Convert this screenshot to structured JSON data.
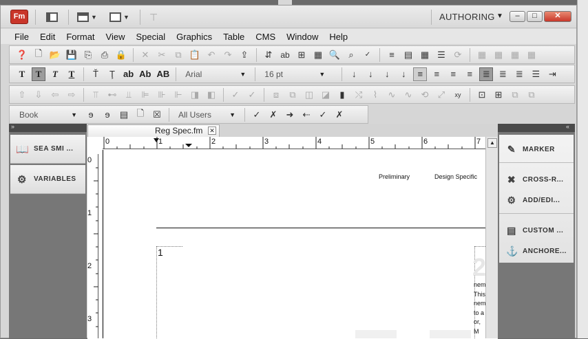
{
  "app": {
    "icon_label": "Fm"
  },
  "workspace": {
    "label": "AUTHORING"
  },
  "window_controls": {
    "minimize": "–",
    "maximize": "□",
    "close": "✕"
  },
  "menu": [
    "File",
    "Edit",
    "Format",
    "View",
    "Special",
    "Graphics",
    "Table",
    "CMS",
    "Window",
    "Help"
  ],
  "toolbar_text": {
    "bold": "T",
    "italic": "T",
    "underline": "T",
    "lower": "ab",
    "title": "Ab",
    "upper": "AB"
  },
  "font_select": {
    "value": "Arial"
  },
  "size_select": {
    "value": "16 pt"
  },
  "book_select": {
    "value": "Book"
  },
  "users_select": {
    "value": "All Users"
  },
  "left_panel": {
    "items": [
      {
        "label": "SEA SMI ...",
        "icon": "book-icon"
      },
      {
        "label": "VARIABLES",
        "icon": "gears-icon"
      }
    ]
  },
  "right_panel": {
    "items": [
      {
        "label": "MARKER",
        "icon": "marker-icon"
      },
      {
        "label": "CROSS-R...",
        "icon": "cross-ref-icon"
      },
      {
        "label": "ADD/EDI...",
        "icon": "add-edit-icon"
      },
      {
        "label": "CUSTOM ...",
        "icon": "custom-icon"
      },
      {
        "label": "ANCHORE...",
        "icon": "anchor-icon"
      }
    ]
  },
  "document": {
    "tab_title": "Reg Spec.fm",
    "ruler_h": [
      "0",
      "1",
      "2",
      "3",
      "4",
      "5",
      "6",
      "7"
    ],
    "ruler_v": [
      "0",
      "1",
      "2",
      "3"
    ],
    "header_left": "Preliminary",
    "header_right": "Design Specific",
    "page_number": "1",
    "big_glyph": "2",
    "fragments": [
      "nem",
      "This",
      "nem",
      "to a",
      "or, M"
    ]
  }
}
